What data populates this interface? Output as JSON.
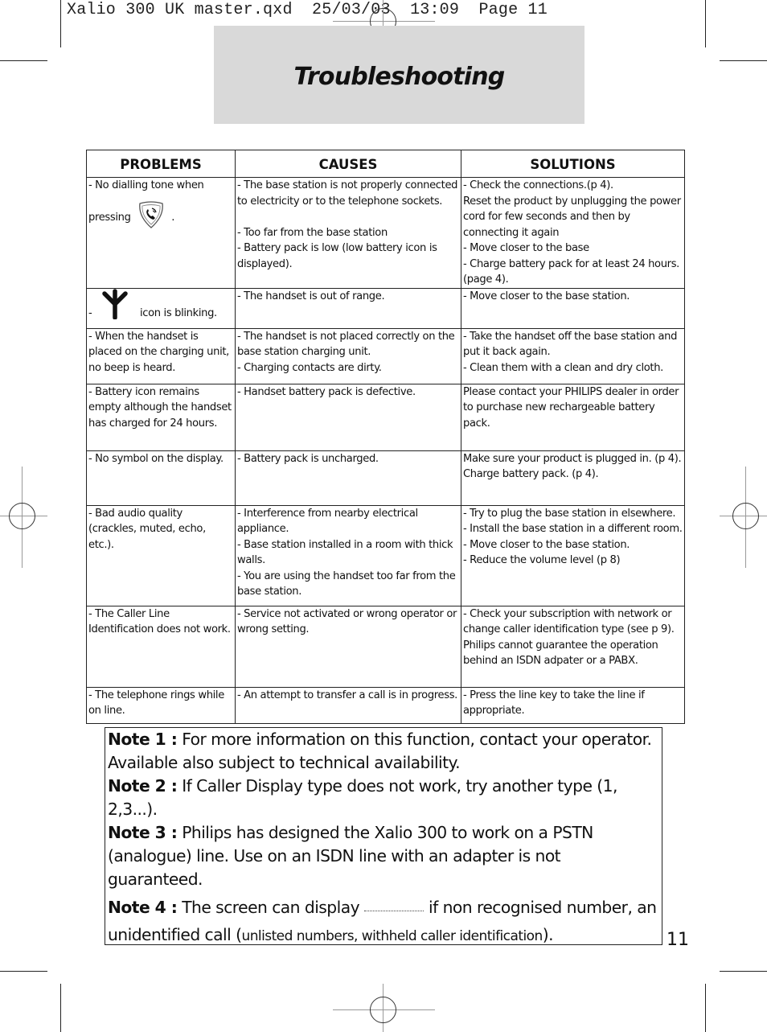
{
  "slug_line": "Xalio 300 UK master.qxd  25/03/03  13:09  Page 11",
  "title": "Troubleshooting",
  "table": {
    "headers": [
      "PROBLEMS",
      "CAUSES",
      "SOLUTIONS"
    ],
    "rows": [
      {
        "problem": {
          "before": "- No dialling tone when",
          "line2": "pressing",
          "icon": "phone-key-icon",
          "after": "."
        },
        "causes": [
          "- The base station is not properly connected to electricity or to the telephone sockets.",
          "",
          "- Too far from the base station",
          "- Battery pack is low (low battery icon is displayed)."
        ],
        "solutions": [
          "- Check the connections.(p 4).",
          "Reset the product by unplugging the power cord for few seconds and then by connecting it again",
          "- Move closer to the base",
          "- Charge battery pack for at least 24 hours. (page 4)."
        ]
      },
      {
        "problem": {
          "before": "-",
          "icon": "antenna-icon",
          "after": "icon is blinking."
        },
        "causes": [
          "- The handset is out of range."
        ],
        "solutions": [
          "- Move closer to the base station."
        ]
      },
      {
        "problem": {
          "text": "- When the handset is placed on the charging unit, no beep is heard."
        },
        "causes": [
          "- The handset is not placed correctly on the base station charging unit.",
          "- Charging contacts are dirty."
        ],
        "solutions": [
          "- Take the handset off the base station and put it back again.",
          "- Clean them with a clean and dry cloth."
        ]
      },
      {
        "problem": {
          "text": "- Battery icon remains empty although the handset has charged for 24 hours."
        },
        "causes": [
          "- Handset battery pack is defective."
        ],
        "solutions": [
          "Please contact your PHILIPS dealer in order to purchase new rechargeable battery pack."
        ]
      },
      {
        "problem": {
          "text": "- No symbol on the display."
        },
        "causes": [
          "- Battery pack is uncharged."
        ],
        "solutions": [
          "Make sure your product is plugged in. (p 4).",
          "Charge battery pack. (p 4)."
        ]
      },
      {
        "problem": {
          "text": "- Bad audio quality (crackles, muted, echo, etc.)."
        },
        "causes": [
          "- Interference from nearby electrical appliance.",
          "- Base station installed in a room with thick walls.",
          "- You are using the handset too far from the base station."
        ],
        "solutions": [
          "- Try to plug the base station in elsewhere.",
          "- Install the base station in a different room.",
          "- Move closer to the base station.",
          "- Reduce the volume level (p 8)"
        ]
      },
      {
        "problem": {
          "text": "- The Caller Line Identification does not work."
        },
        "causes": [
          "- Service not activated or wrong operator or wrong setting."
        ],
        "solutions": [
          "- Check your subscription with network or change caller identification type (see p 9).",
          "Philips cannot guarantee the operation behind an ISDN adpater or a PABX."
        ]
      },
      {
        "problem": {
          "text": "- The telephone rings while on line."
        },
        "causes": [
          "- An attempt to transfer a call is in progress."
        ],
        "solutions": [
          "- Press the line key to take the line if appropriate."
        ]
      }
    ]
  },
  "notes": [
    {
      "label": "Note 1 :",
      "text": "For more information on this function, contact your operator. Available also subject to technical availability."
    },
    {
      "label": "Note 2 :",
      "text": "If Caller Display type does not work, try another type (1, 2,3...)."
    },
    {
      "label": "Note 3 :",
      "text": "Philips has designed the Xalio 300 to work on a PSTN (analogue) line. Use on an ISDN line with an adapter is not guaranteed."
    },
    {
      "label": "Note 4 :",
      "text_before": "The screen can display",
      "text_after": "if non recognised number, an unidentified call (",
      "small_text": "unlisted numbers, withheld caller identification",
      "text_end": ")."
    }
  ],
  "page_number": "11"
}
